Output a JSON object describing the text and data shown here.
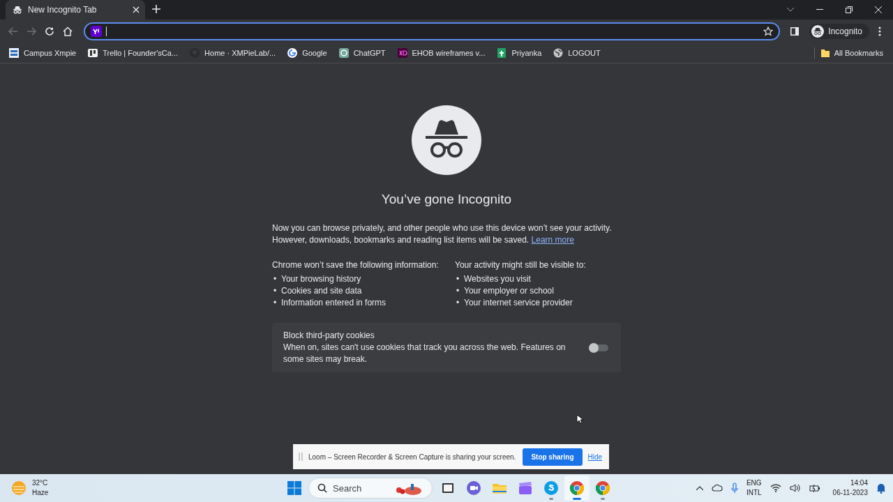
{
  "tab": {
    "title": "New Incognito Tab"
  },
  "toolbar": {
    "profile": "Incognito"
  },
  "bookmarks": [
    {
      "kind": "xmpie",
      "label": "Campus Xmpie"
    },
    {
      "kind": "trello",
      "label": "Trello | Founder'sCa..."
    },
    {
      "kind": "github",
      "label": "Home · XMPieLab/..."
    },
    {
      "kind": "google",
      "label": "Google"
    },
    {
      "kind": "chatgpt",
      "label": "ChatGPT"
    },
    {
      "kind": "xd",
      "label": "EHOB wireframes v..."
    },
    {
      "kind": "sheets",
      "label": "Priyanka"
    },
    {
      "kind": "globe",
      "label": "LOGOUT"
    }
  ],
  "all_bookmarks": "All Bookmarks",
  "page": {
    "heading": "You’ve gone Incognito",
    "intro": "Now you can browse privately, and other people who use this device won’t see your activity. However, downloads, bookmarks and reading list items will be saved.",
    "learn_more": "Learn more",
    "columns": [
      {
        "title": "Chrome won’t save the following information:",
        "marker": "•",
        "items": [
          "Your browsing history",
          "Cookies and site data",
          "Information entered in forms"
        ]
      },
      {
        "title": "Your activity might still be visible to:",
        "marker": "•",
        "items": [
          "Websites you visit",
          "Your employer or school",
          "Your internet service provider"
        ]
      }
    ],
    "cookie_card": {
      "title": "Block third-party cookies",
      "description": "When on, sites can't use cookies that track you across the web. Features on some sites may break.",
      "on": false
    }
  },
  "share_banner": {
    "message": "Loom – Screen Recorder & Screen Capture is sharing your screen.",
    "stop_button": "Stop sharing",
    "hide_link": "Hide"
  },
  "taskbar": {
    "temperature": "32°C",
    "condition": "Haze",
    "search_label": "Search",
    "apps": [
      {
        "kind": "explorer",
        "selected": false,
        "running": false
      },
      {
        "kind": "meet",
        "selected": false,
        "running": false
      },
      {
        "kind": "folder",
        "selected": false,
        "running": false
      },
      {
        "kind": "clapper",
        "selected": false,
        "running": false
      },
      {
        "kind": "skype",
        "selected": false,
        "running": true
      },
      {
        "kind": "chrome",
        "selected": true,
        "running": true
      },
      {
        "kind": "chrome",
        "selected": false,
        "running": true
      }
    ],
    "language": "ENG",
    "layout": "INTL",
    "time": "14:04",
    "date": "06-11-2023"
  }
}
